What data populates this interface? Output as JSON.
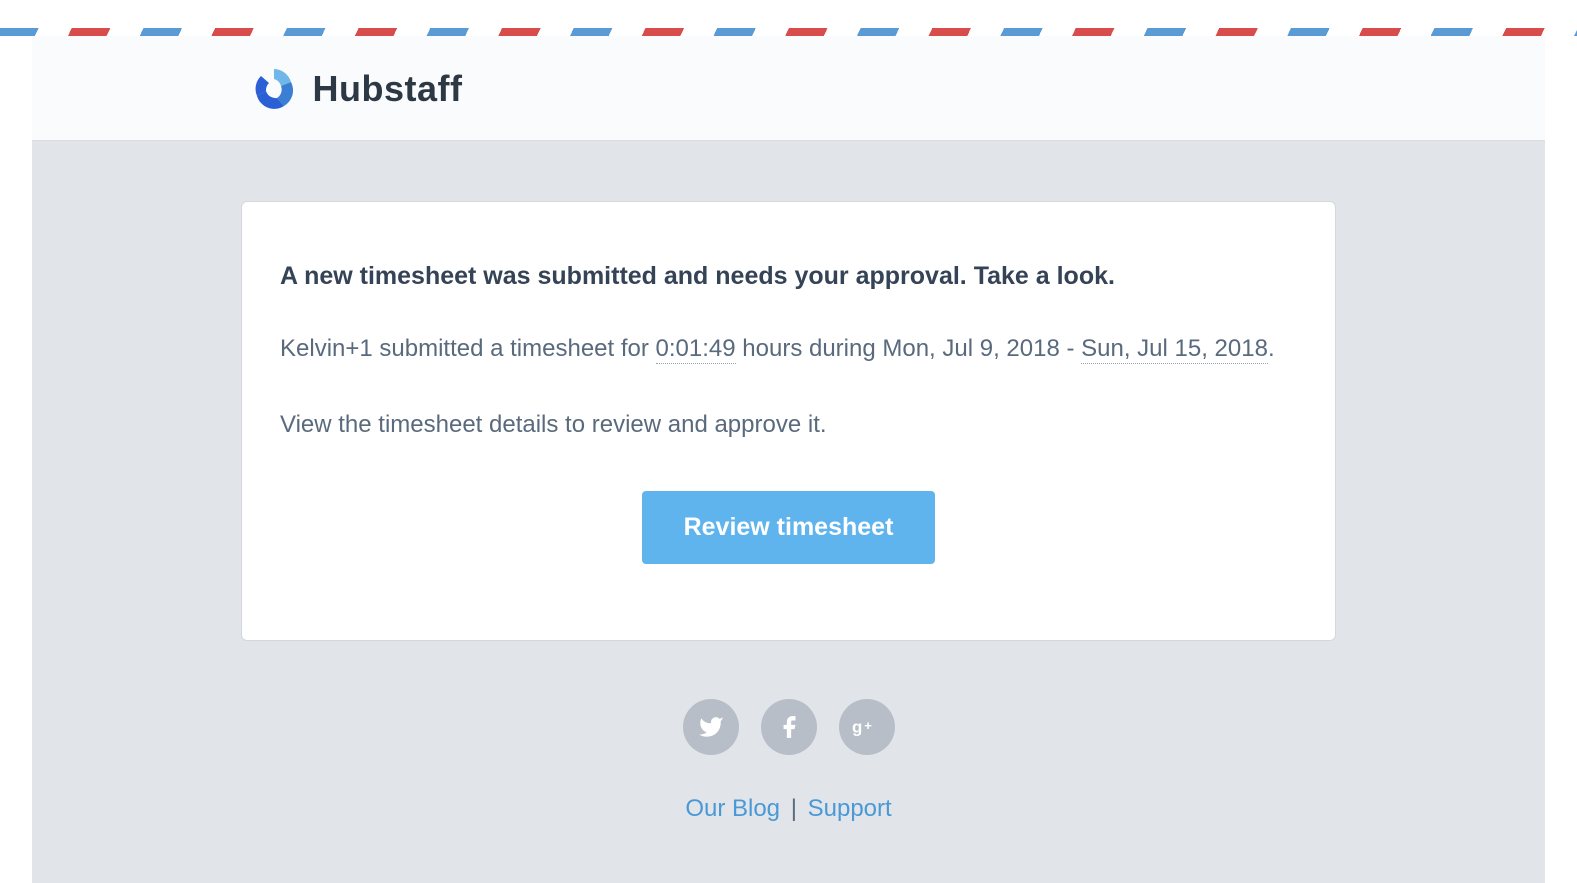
{
  "brand": {
    "name": "Hubstaff"
  },
  "message": {
    "heading": "A new timesheet was submitted and needs your approval. Take a look.",
    "body_prefix": "Kelvin+1 submitted a timesheet for ",
    "hours": "0:01:49",
    "body_mid": " hours during Mon, Jul 9, 2018 - ",
    "date_end": "Sun, Jul 15, 2018",
    "body_suffix": ".",
    "instruction": "View the timesheet details to review and approve it.",
    "button_label": "Review timesheet"
  },
  "footer": {
    "blog_label": "Our Blog",
    "divider": " | ",
    "support_label": "Support"
  }
}
